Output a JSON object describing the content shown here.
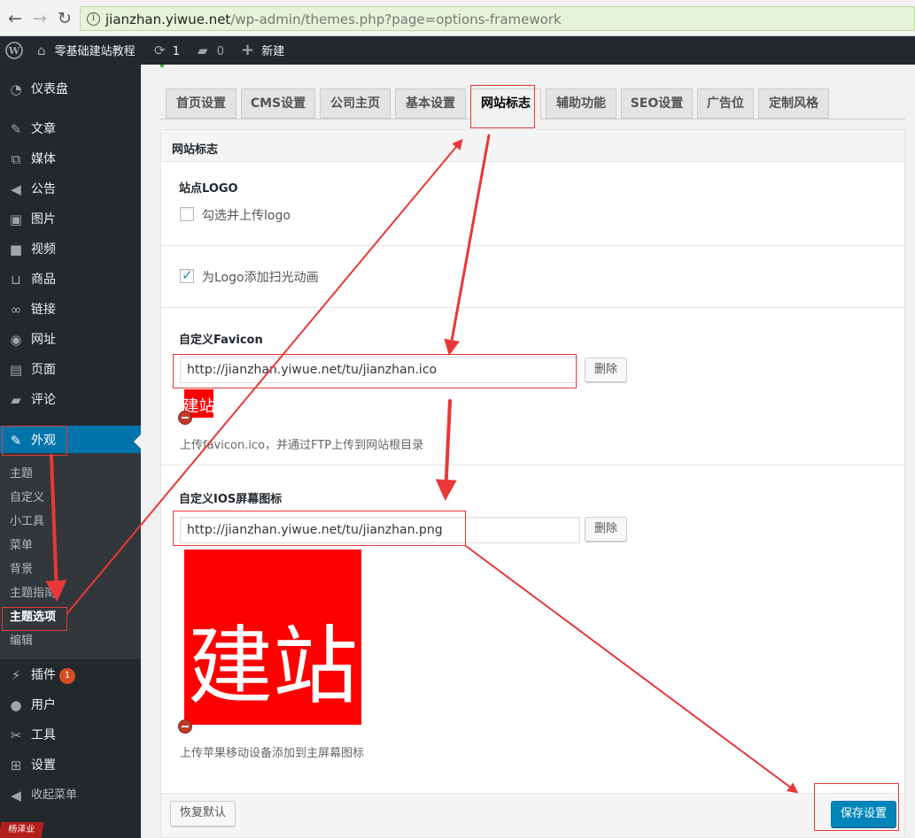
{
  "browser": {
    "back_icon": "arrow-left-icon",
    "forward_icon": "arrow-right-icon",
    "reload_icon": "reload-icon",
    "url_host": "jianzhan.yiwue.net",
    "url_path": "/wp-admin/themes.php?page=options-framework"
  },
  "admin_bar": {
    "site_name": "零基础建站教程",
    "updates_count": "1",
    "comments_count": "0",
    "new_label": "新建"
  },
  "sidebar": {
    "items": [
      {
        "label": "仪表盘",
        "icon": "dashboard-icon"
      },
      {
        "label": "文章",
        "icon": "pin-icon"
      },
      {
        "label": "媒体",
        "icon": "media-icon"
      },
      {
        "label": "公告",
        "icon": "megaphone-icon"
      },
      {
        "label": "图片",
        "icon": "image-icon"
      },
      {
        "label": "视频",
        "icon": "video-icon"
      },
      {
        "label": "商品",
        "icon": "cart-icon"
      },
      {
        "label": "链接",
        "icon": "link-icon"
      },
      {
        "label": "网址",
        "icon": "globe-icon"
      },
      {
        "label": "页面",
        "icon": "page-icon"
      },
      {
        "label": "评论",
        "icon": "comment-icon"
      },
      {
        "label": "外观",
        "icon": "brush-icon"
      }
    ],
    "submenu": [
      "主题",
      "自定义",
      "小工具",
      "菜单",
      "背景",
      "主题指南",
      "主题选项",
      "编辑"
    ],
    "bottom_items": [
      {
        "label": "插件",
        "icon": "plugin-icon",
        "badge": "1"
      },
      {
        "label": "用户",
        "icon": "user-icon"
      },
      {
        "label": "工具",
        "icon": "wrench-icon"
      },
      {
        "label": "设置",
        "icon": "settings-icon"
      },
      {
        "label": "收起菜单",
        "icon": "collapse-icon"
      }
    ]
  },
  "tabs": [
    "首页设置",
    "CMS设置",
    "公司主页",
    "基本设置",
    "网站标志",
    "辅助功能",
    "SEO设置",
    "广告位",
    "定制风格"
  ],
  "panel": {
    "title": "网站标志",
    "logo": {
      "heading": "站点LOGO",
      "checkbox_label": "勾选并上传logo",
      "checked": false
    },
    "shine": {
      "checkbox_label": "为Logo添加扫光动画",
      "checked": true
    },
    "favicon": {
      "heading": "自定义Favicon",
      "value": "http://jianzhan.yiwue.net/tu/jianzhan.ico",
      "remove_label": "删除",
      "preview_text": "建站",
      "description": "上传favicon.ico，并通过FTP上传到网站根目录"
    },
    "ios_icon": {
      "heading": "自定义IOS屏幕图标",
      "value": "http://jianzhan.yiwue.net/tu/jianzhan.png",
      "remove_label": "删除",
      "preview_text": "建站",
      "description": "上传苹果移动设备添加到主屏幕图标"
    },
    "reset_label": "恢复默认",
    "save_label": "保存设置"
  },
  "watermark": "杨泽业",
  "colors": {
    "accent": "#0073aa",
    "annotation": "#e03a3a",
    "preview_bg": "#ff0000"
  }
}
